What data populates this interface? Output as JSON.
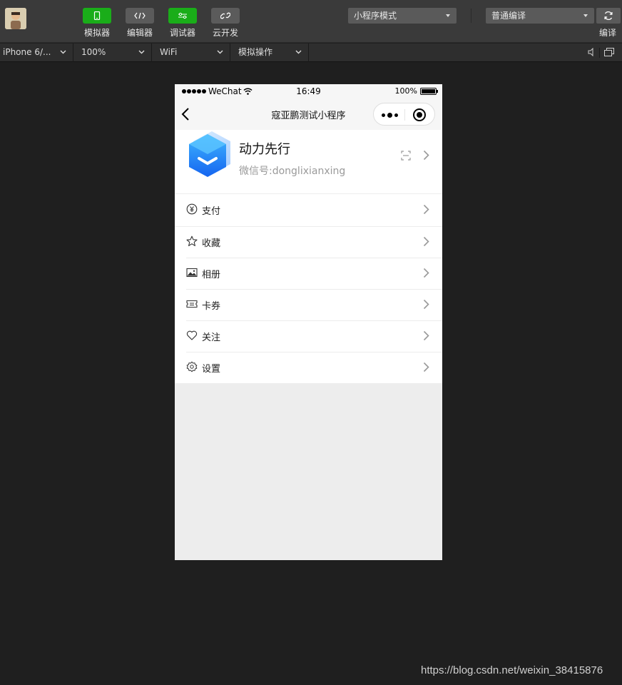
{
  "toolbar": {
    "tools": [
      {
        "label": "模拟器",
        "icon": "phone-icon"
      },
      {
        "label": "编辑器",
        "icon": "code-icon"
      },
      {
        "label": "调试器",
        "icon": "debug-icon"
      },
      {
        "label": "云开发",
        "icon": "cloud-link-icon"
      }
    ],
    "mode_select": "小程序模式",
    "compile_select": "普通编译",
    "compile_label": "编译"
  },
  "subbar": {
    "device": "iPhone 6/...",
    "zoom": "100%",
    "network": "WiFi",
    "operation": "模拟操作"
  },
  "phone": {
    "status": {
      "carrier": "WeChat",
      "time": "16:49",
      "battery": "100%"
    },
    "nav_title": "寇亚鹏测试小程序",
    "profile": {
      "name": "动力先行",
      "wechat_id": "微信号:donglixianxing"
    },
    "menu": [
      {
        "label": "支付",
        "icon": "yuan-circle-icon"
      },
      {
        "label": "收藏",
        "icon": "star-icon"
      },
      {
        "label": "相册",
        "icon": "image-icon"
      },
      {
        "label": "卡券",
        "icon": "ticket-icon"
      },
      {
        "label": "关注",
        "icon": "heart-icon"
      },
      {
        "label": "设置",
        "icon": "gear-icon"
      }
    ]
  },
  "watermark": "https://blog.csdn.net/weixin_38415876",
  "colors": {
    "accent_green": "#1aad19",
    "toolbar_bg": "#3a3a3a",
    "app_bg": "#1f1f1f"
  }
}
